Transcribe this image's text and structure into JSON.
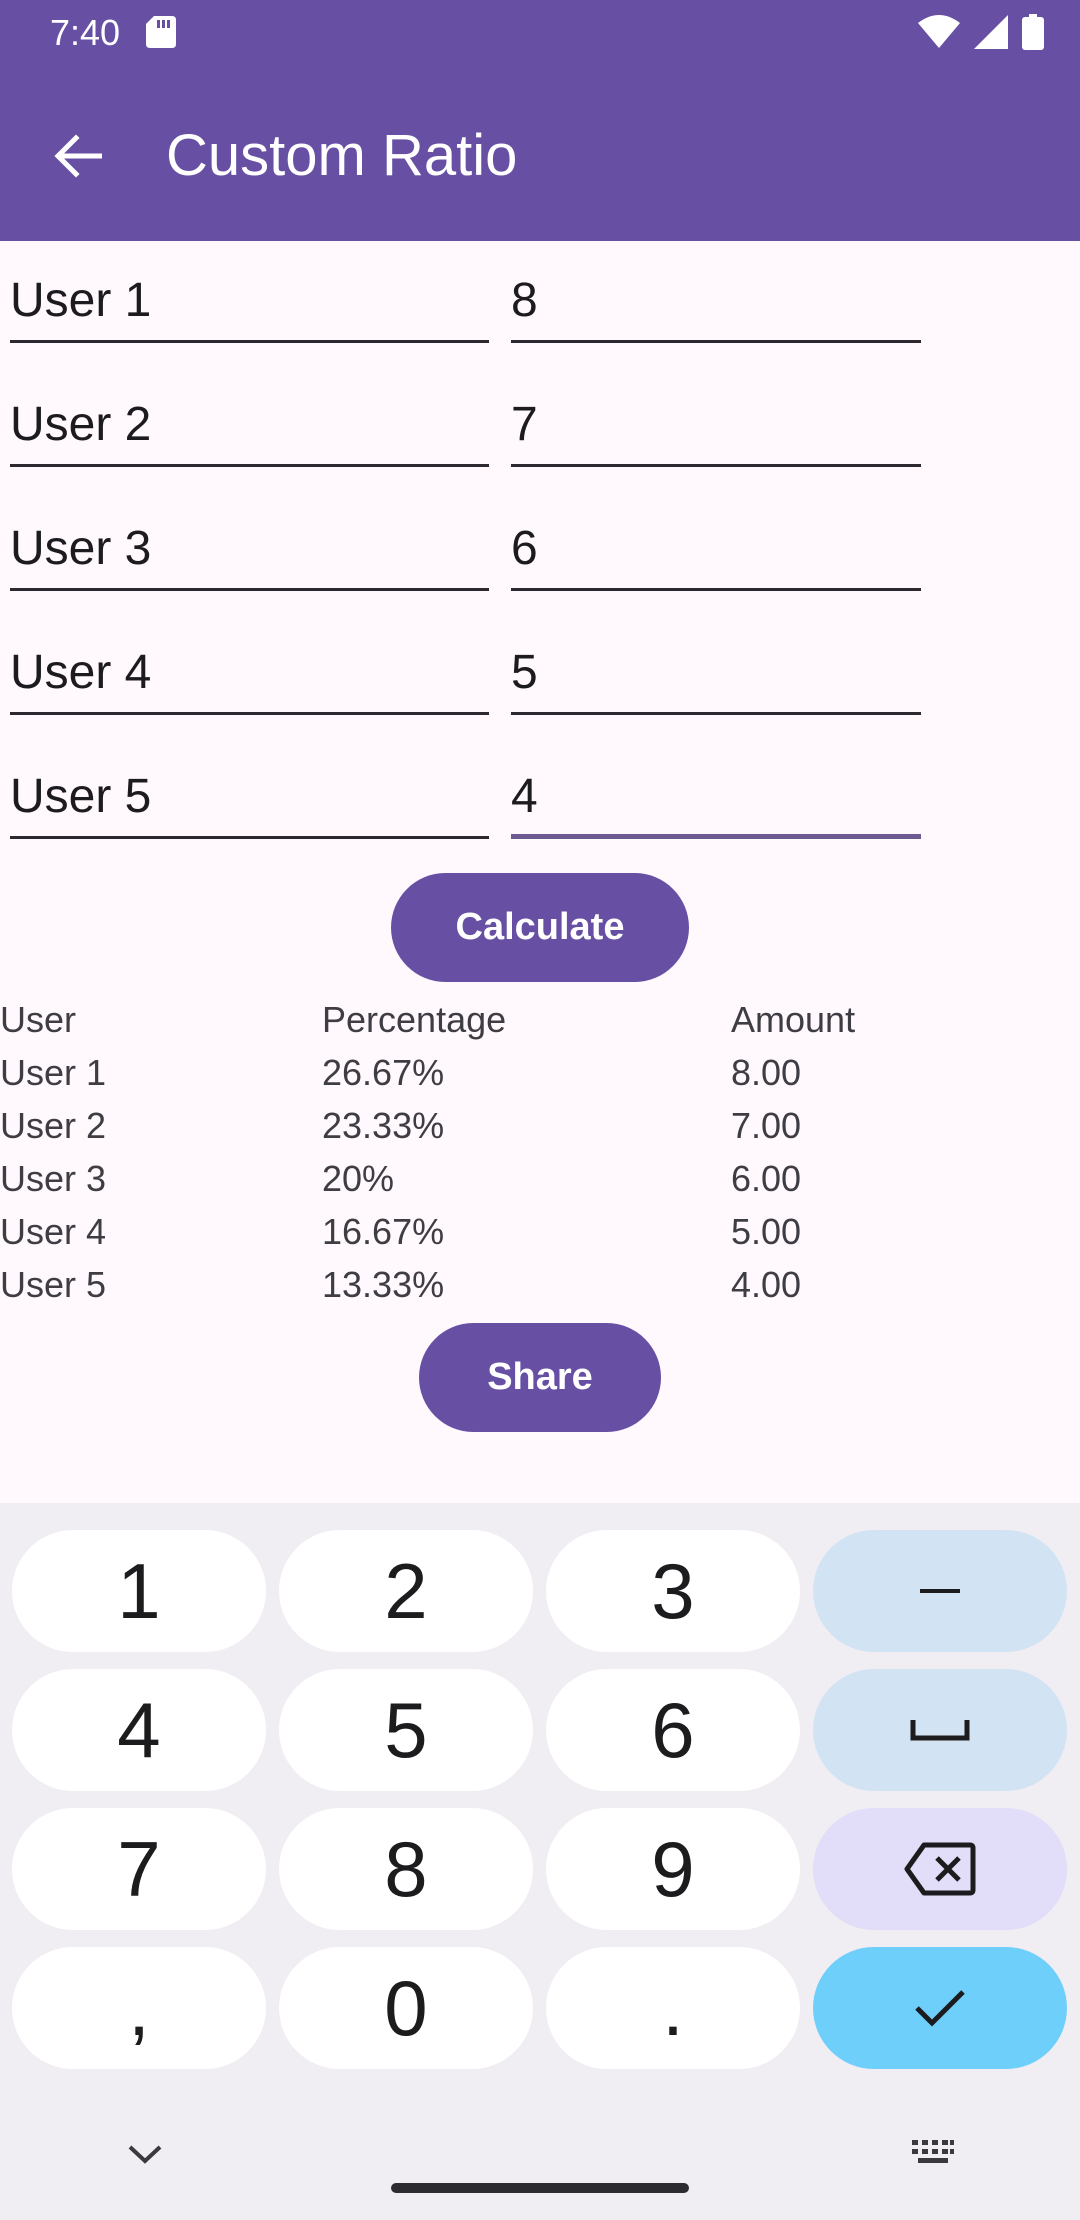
{
  "status_bar": {
    "time": "7:40"
  },
  "app_bar": {
    "title": "Custom Ratio"
  },
  "inputs": [
    {
      "name": "User 1",
      "value": "8"
    },
    {
      "name": "User 2",
      "value": "7"
    },
    {
      "name": "User 3",
      "value": "6"
    },
    {
      "name": "User 4",
      "value": "5"
    },
    {
      "name": "User 5",
      "value": "4"
    }
  ],
  "buttons": {
    "calculate": "Calculate",
    "share": "Share"
  },
  "results": {
    "headers": [
      "User",
      "Percentage",
      "Amount"
    ],
    "rows": [
      [
        "User 1",
        "26.67%",
        "8.00"
      ],
      [
        "User 2",
        "23.33%",
        "7.00"
      ],
      [
        "User 3",
        "20%",
        "6.00"
      ],
      [
        "User 4",
        "16.67%",
        "5.00"
      ],
      [
        "User 5",
        "13.33%",
        "4.00"
      ]
    ]
  },
  "keyboard": {
    "keys": [
      "1",
      "2",
      "3",
      "–",
      "4",
      "5",
      "6",
      "␣",
      "7",
      "8",
      "9",
      "⌫",
      ",",
      "0",
      ".",
      "✓"
    ]
  },
  "colors": {
    "primary": "#6750a4",
    "background": "#fff8fd",
    "key_fn": "#d2e3f3",
    "key_delete": "#e2ddf8",
    "key_enter": "#6fcffb",
    "focused_underline": "#6d5b91"
  }
}
